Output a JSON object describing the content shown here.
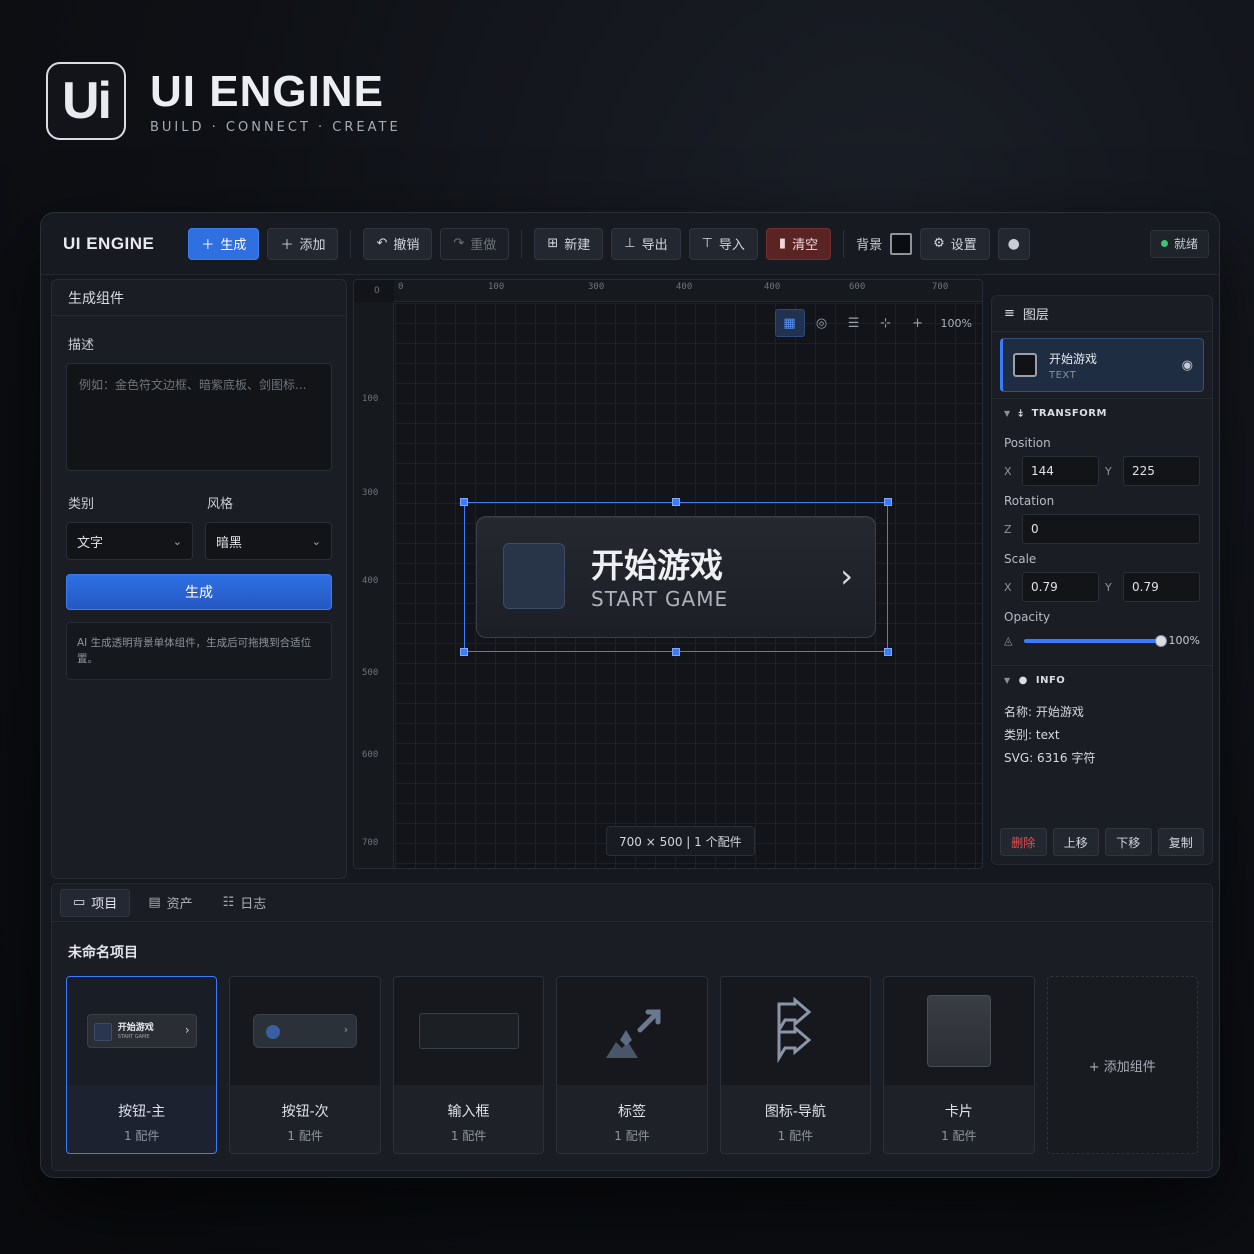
{
  "brand": {
    "logo": "Ui",
    "name": "UI ENGINE",
    "tagline": "BUILD · CONNECT · CREATE"
  },
  "toolbar": {
    "app_title": "UI ENGINE",
    "generate": "生成",
    "add": "添加",
    "undo": "撤销",
    "redo": "重做",
    "new": "新建",
    "export": "导出",
    "import": "导入",
    "clear": "清空",
    "background_label": "背景",
    "settings": "设置",
    "status": "就绪",
    "icons": {
      "generate": "plus-icon",
      "add": "plus-icon",
      "undo": "undo-icon",
      "redo": "redo-icon",
      "new": "grid-icon",
      "export": "export-icon",
      "import": "import-icon",
      "clear": "trash-icon",
      "settings": "gear-icon",
      "user": "user-icon"
    },
    "background_color": "#0c0d10"
  },
  "left_panel": {
    "title": "生成组件",
    "description_label": "描述",
    "description_placeholder": "例如：金色符文边框、暗紫底板、剑图标...",
    "category_label": "类别",
    "category_value": "文字",
    "style_label": "风格",
    "style_value": "暗黑",
    "generate_button": "生成",
    "hint": "AI 生成透明背景单体组件，生成后可拖拽到合适位置。"
  },
  "canvas": {
    "ruler_origin": "0",
    "ruler_top": [
      "0",
      "100",
      "300",
      "400",
      "400",
      "600",
      "700"
    ],
    "ruler_left": [
      "100",
      "300",
      "400",
      "500",
      "600",
      "700"
    ],
    "zoom": "100%",
    "info": "700 × 500 | 1 个配件",
    "element": {
      "title": "开始游戏",
      "subtitle": "START GAME",
      "arrow": "›"
    }
  },
  "layers": {
    "title": "图层",
    "item_name": "开始游戏",
    "item_type": "TEXT"
  },
  "transform": {
    "title": "TRANSFORM",
    "position_label": "Position",
    "pos_x_label": "X",
    "pos_x": "144",
    "pos_y_label": "Y",
    "pos_y": "225",
    "rotation_label": "Rotation",
    "rot_z_label": "Z",
    "rot_z": "0",
    "scale_label": "Scale",
    "scale_x_label": "X",
    "scale_x": "0.79",
    "scale_y_label": "Y",
    "scale_y": "0.79",
    "opacity_label": "Opacity",
    "opacity_value": "100%",
    "opacity_fraction": 1.0
  },
  "info": {
    "title": "INFO",
    "name": "名称: 开始游戏",
    "type": "类别: text",
    "svg": "SVG: 6316 字符"
  },
  "layer_actions": {
    "delete": "删除",
    "up": "上移",
    "down": "下移",
    "copy": "复制"
  },
  "bottom": {
    "tabs": [
      "项目",
      "资产",
      "日志"
    ],
    "project_title": "未命名项目",
    "cards": [
      {
        "name": "按钮-主",
        "count": "1 配件",
        "thumb_title": "开始游戏",
        "thumb_sub": "START GAME"
      },
      {
        "name": "按钮-次",
        "count": "1 配件"
      },
      {
        "name": "输入框",
        "count": "1 配件"
      },
      {
        "name": "标签",
        "count": "1 配件"
      },
      {
        "name": "图标-导航",
        "count": "1 配件"
      },
      {
        "name": "卡片",
        "count": "1 配件"
      }
    ],
    "add_card": "+ 添加组件"
  },
  "colors": {
    "accent": "#3b7cff",
    "danger": "#e05252",
    "status_ok": "#3cc46e"
  }
}
